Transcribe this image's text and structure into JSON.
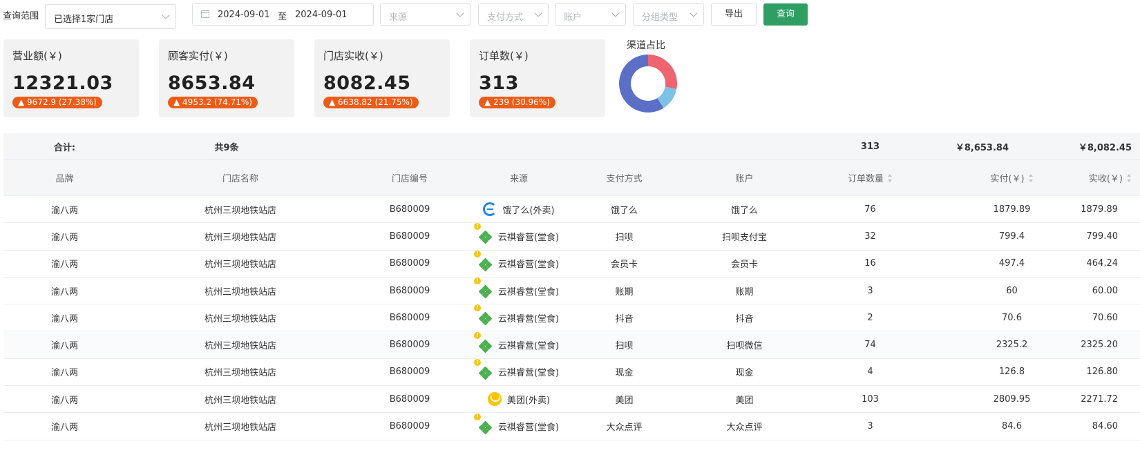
{
  "filters": {
    "scope_label": "查询范围",
    "store_select": "已选择1家门店",
    "date_start": "2024-09-01",
    "date_sep": "至",
    "date_end": "2024-09-01",
    "source_placeholder": "来源",
    "pay_placeholder": "支付方式",
    "account_placeholder": "账户",
    "group_placeholder": "分组类型",
    "export_label": "导出",
    "query_label": "查询"
  },
  "kpis": [
    {
      "label": "营业额(￥)",
      "value": "12321.03",
      "badge": "▲ 9672.9 (27.38%)"
    },
    {
      "label": "顾客实付(￥)",
      "value": "8653.84",
      "badge": "▲ 4953.2 (74.71%)"
    },
    {
      "label": "门店实收(￥)",
      "value": "8082.45",
      "badge": "▲ 6638.82 (21.75%)"
    },
    {
      "label": "订单数(￥)",
      "value": "313",
      "badge": "▲ 239 (30.96%)"
    }
  ],
  "channel_chart": {
    "title": "渠道占比",
    "colors": [
      "#ee6470",
      "#7ec1e6",
      "#5b6fc7"
    ],
    "segments": [
      0.28,
      0.13,
      0.59
    ]
  },
  "summary": {
    "label": "合计:",
    "count": "共9条",
    "orders": "313",
    "paid": "￥8,653.84",
    "received": "￥8,082.45"
  },
  "columns": {
    "brand": "品牌",
    "store": "门店名称",
    "code": "门店编号",
    "source": "来源",
    "pay": "支付方式",
    "account": "账户",
    "orders": "订单数量",
    "paid": "实付(￥)",
    "received": "实收(￥)"
  },
  "rows": [
    {
      "brand": "渝八两",
      "store": "杭州三坝地铁站店",
      "code": "B680009",
      "source": "饿了么(外卖)",
      "source_icon": "eleme-icon",
      "pay": "饿了么",
      "account": "饿了么",
      "orders": "76",
      "paid": "1879.89",
      "received": "1879.89"
    },
    {
      "brand": "渝八两",
      "store": "杭州三坝地铁站店",
      "code": "B680009",
      "source": "云祺睿营(堂食)",
      "source_icon": "yunqi-icon",
      "pay": "扫呗",
      "account": "扫呗支付宝",
      "orders": "32",
      "paid": "799.4",
      "received": "799.40"
    },
    {
      "brand": "渝八两",
      "store": "杭州三坝地铁站店",
      "code": "B680009",
      "source": "云祺睿营(堂食)",
      "source_icon": "yunqi-icon",
      "pay": "会员卡",
      "account": "会员卡",
      "orders": "16",
      "paid": "497.4",
      "received": "464.24"
    },
    {
      "brand": "渝八两",
      "store": "杭州三坝地铁站店",
      "code": "B680009",
      "source": "云祺睿营(堂食)",
      "source_icon": "yunqi-icon",
      "pay": "账期",
      "account": "账期",
      "orders": "3",
      "paid": "60",
      "received": "60.00"
    },
    {
      "brand": "渝八两",
      "store": "杭州三坝地铁站店",
      "code": "B680009",
      "source": "云祺睿营(堂食)",
      "source_icon": "yunqi-icon",
      "pay": "抖音",
      "account": "抖音",
      "orders": "2",
      "paid": "70.6",
      "received": "70.60"
    },
    {
      "brand": "渝八两",
      "store": "杭州三坝地铁站店",
      "code": "B680009",
      "source": "云祺睿营(堂食)",
      "source_icon": "yunqi-icon",
      "pay": "扫呗",
      "account": "扫呗微信",
      "orders": "74",
      "paid": "2325.2",
      "received": "2325.20"
    },
    {
      "brand": "渝八两",
      "store": "杭州三坝地铁站店",
      "code": "B680009",
      "source": "云祺睿营(堂食)",
      "source_icon": "yunqi-icon",
      "pay": "现金",
      "account": "现金",
      "orders": "4",
      "paid": "126.8",
      "received": "126.80"
    },
    {
      "brand": "渝八两",
      "store": "杭州三坝地铁站店",
      "code": "B680009",
      "source": "美团(外卖)",
      "source_icon": "meituan-icon",
      "pay": "美团",
      "account": "美团",
      "orders": "103",
      "paid": "2809.95",
      "received": "2271.72"
    },
    {
      "brand": "渝八两",
      "store": "杭州三坝地铁站店",
      "code": "B680009",
      "source": "云祺睿营(堂食)",
      "source_icon": "yunqi-icon",
      "pay": "大众点评",
      "account": "大众点评",
      "orders": "3",
      "paid": "84.6",
      "received": "84.60"
    }
  ]
}
